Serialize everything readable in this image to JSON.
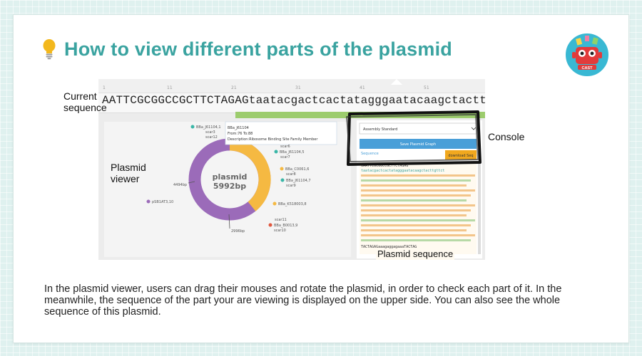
{
  "slide": {
    "title": "How to view different parts of the plasmid",
    "logo_text": "CAST",
    "description": "In the plasmid viewer, users can drag their mouses and rotate the plasmid, in order to check each part of it. In the meanwhile, the sequence of the part your are viewing is displayed on the upper side. You can also see the whole sequence of this plasmid."
  },
  "labels": {
    "current_sequence_line1": "Current",
    "current_sequence_line2": "sequence",
    "plasmid_viewer_line1": "Plasmid",
    "plasmid_viewer_line2": "viewer",
    "console": "Console",
    "plasmid_sequence": "Plasmid sequence"
  },
  "screenshot": {
    "sequence": "AATTCGCGGCCGCTTCTAGAGtaatacgactcactatagggaatacaagctacttgttct",
    "ruler": [
      "1",
      "11",
      "21",
      "31",
      "41",
      "51"
    ],
    "plasmid_name": "plasmid",
    "plasmid_size": "5992bp",
    "tooltip": {
      "name": "BBa_J61104",
      "range": "From:76 To:88",
      "description": "Description:Ribosome Binding Site Family Member"
    },
    "features": [
      "BBa_J61104,1",
      "scar3",
      "scar12",
      "scar6",
      "BBa_J61104,5",
      "scar7",
      "BBa_C0061,6",
      "scar8",
      "BBa_J61104,7",
      "scar9",
      "BBa_K518003,8",
      "scar11",
      "BBa_B0013,9",
      "scar10",
      "pSB1AT3,10"
    ],
    "tick_labels": [
      "4494bp",
      "2996bp"
    ],
    "console": {
      "select_value": "Assembly Standard",
      "button_label": "Save Plasmid Graph",
      "sequence_label": "Sequence",
      "download_label": "download Seq"
    },
    "sequence_lines": [
      "GAATTCGCGGCCGCTTCTAGAG",
      "taatacgactcactatagggaatacaagctacttgttct",
      "TACTAGAGaaagaggagaaaTACTAG"
    ]
  },
  "colors": {
    "title": "#3aa3a0",
    "ring_purple": "#9b6bb9",
    "ring_orange": "#f5b942",
    "console_button": "#4a9fd8",
    "download_button": "#f1a81e",
    "sequence_green": "#9ccc6d"
  }
}
